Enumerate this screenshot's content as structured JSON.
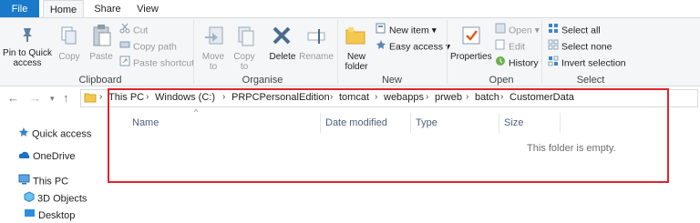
{
  "tabs": [
    {
      "label": "File"
    },
    {
      "label": "Home"
    },
    {
      "label": "Share"
    },
    {
      "label": "View"
    }
  ],
  "ribbon": {
    "clipboard": {
      "group_label": "Clipboard",
      "pin_label": "Pin to Quick access",
      "copy_label": "Copy",
      "paste_label": "Paste",
      "cut_label": "Cut",
      "copy_path_label": "Copy path",
      "paste_shortcut_label": "Paste shortcut"
    },
    "organise": {
      "group_label": "Organise",
      "move_to_label": "Move to",
      "copy_to_label": "Copy to",
      "delete_label": "Delete",
      "rename_label": "Rename"
    },
    "new": {
      "group_label": "New",
      "new_folder_label": "New folder",
      "new_item_label": "New item",
      "easy_access_label": "Easy access"
    },
    "open": {
      "group_label": "Open",
      "properties_label": "Properties",
      "open_label": "Open",
      "edit_label": "Edit",
      "history_label": "History"
    },
    "select": {
      "group_label": "Select",
      "select_all_label": "Select all",
      "select_none_label": "Select none",
      "invert_selection_label": "Invert selection"
    }
  },
  "address": {
    "crumbs": [
      "This PC",
      "Windows (C:)",
      "PRPCPersonalEdition",
      "tomcat",
      "webapps",
      "prweb",
      "batch",
      "CustomerData"
    ]
  },
  "nav_pane": {
    "items": [
      {
        "label": "Quick access"
      },
      {
        "label": "OneDrive"
      },
      {
        "label": "This PC"
      },
      {
        "label": "3D Objects"
      },
      {
        "label": "Desktop"
      }
    ]
  },
  "columns": {
    "name": "Name",
    "date_modified": "Date modified",
    "type": "Type",
    "size": "Size"
  },
  "empty_message": "This folder is empty.",
  "colors": {
    "file_tab": "#1979ca",
    "highlight": "#e0252d",
    "ribbon_bg": "#f5f6f7"
  }
}
